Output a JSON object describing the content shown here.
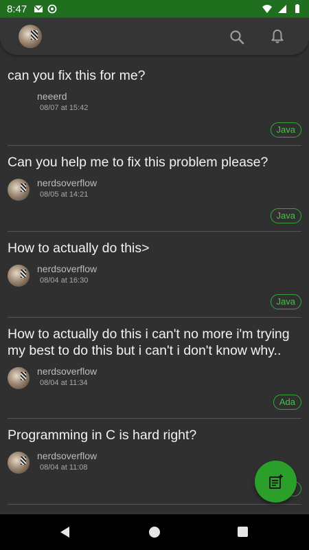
{
  "status_bar": {
    "time": "8:47"
  },
  "app_bar": {
    "avatar_alt": "profile"
  },
  "posts": [
    {
      "title": "can you fix this for me?",
      "author": "neeerd",
      "date": "08/07 at 15:42",
      "tag": "Java",
      "has_avatar": false
    },
    {
      "title": "Can you help me to fix this problem please?",
      "author": "nerdsoverflow",
      "date": "08/05 at 14:21",
      "tag": "Java",
      "has_avatar": true
    },
    {
      "title": "How to actually do this>",
      "author": "nerdsoverflow",
      "date": "08/04 at 16:30",
      "tag": "Java",
      "has_avatar": true
    },
    {
      "title": "How to actually do this i can't no more i'm trying my best to do this but i can't i don't know why..",
      "author": "nerdsoverflow",
      "date": "08/04 at 11:34",
      "tag": "Ada",
      "has_avatar": true
    },
    {
      "title": "Programming in C is hard right?",
      "author": "nerdsoverflow",
      "date": "08/04 at 11:08",
      "tag": "",
      "has_avatar": true
    }
  ],
  "colors": {
    "accent": "#2aa02a",
    "status_bar": "#1f6f1f",
    "background": "#303030"
  },
  "icons": {
    "search": "search-icon",
    "bell": "bell-icon",
    "fab": "new-post-icon"
  }
}
